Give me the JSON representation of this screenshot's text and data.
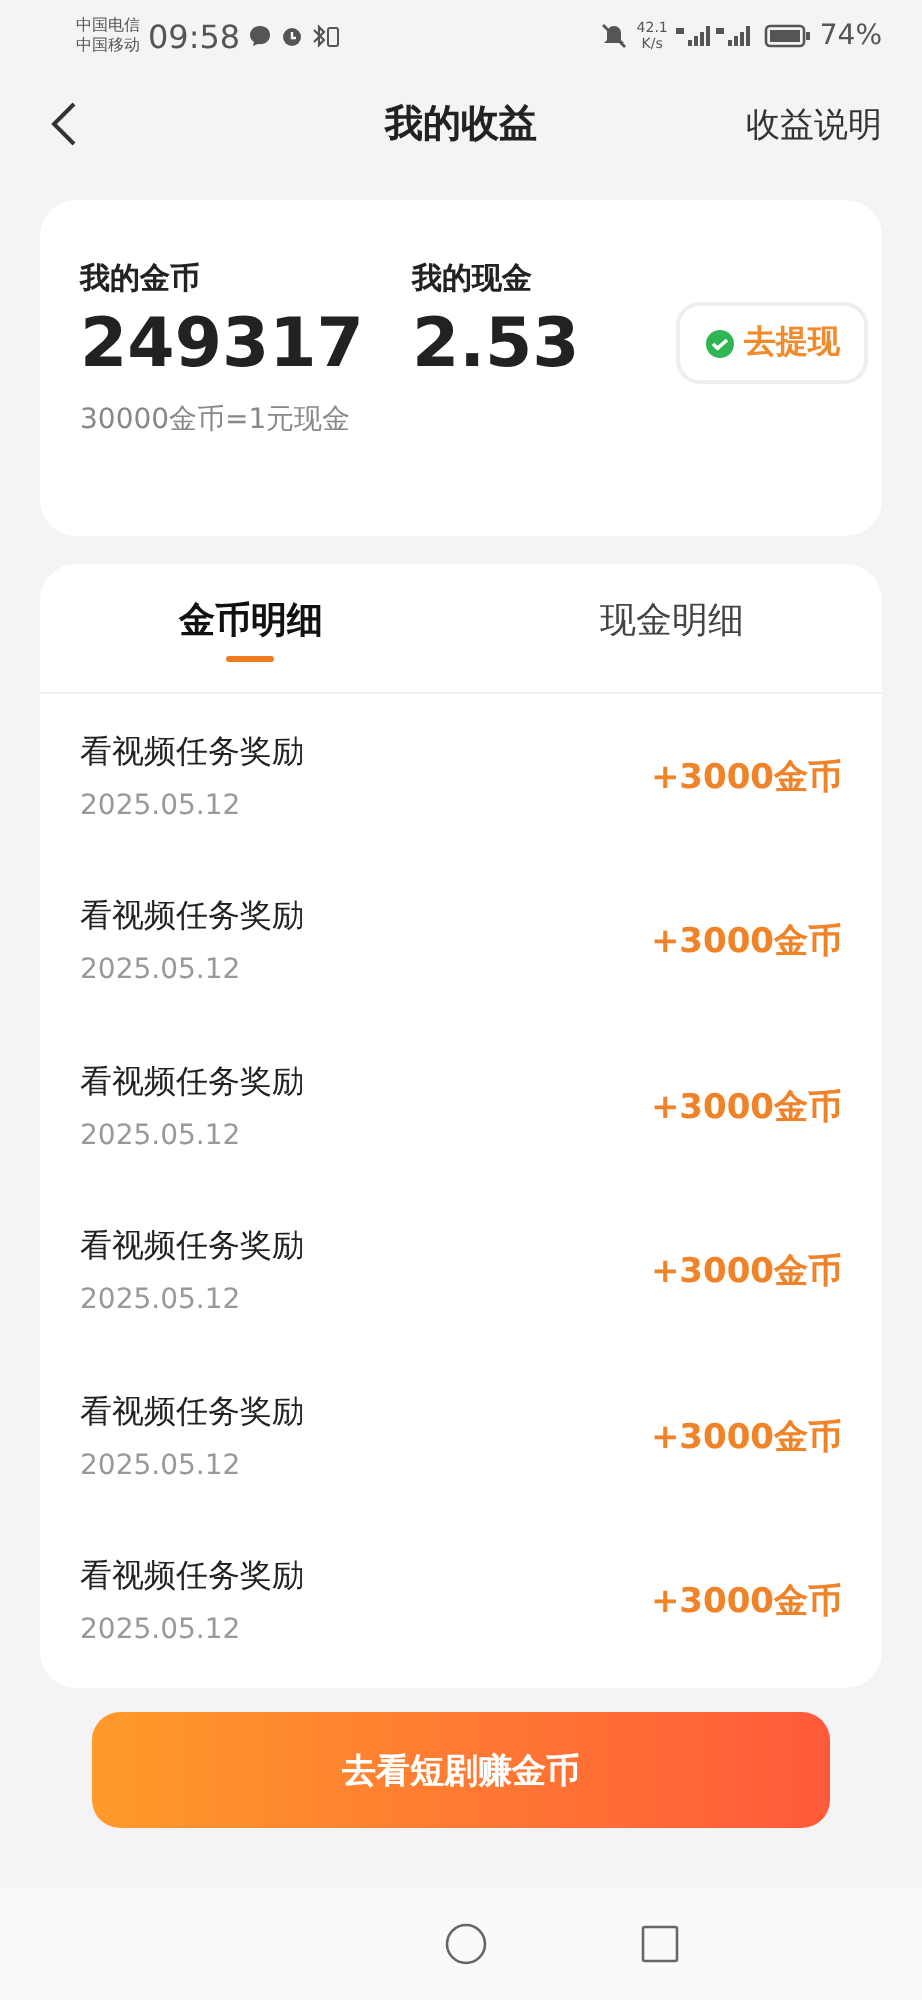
{
  "status_bar": {
    "carrier_1": "中国电信",
    "carrier_2": "中国移动",
    "time": "09:58",
    "speed": "42.1",
    "speed_unit": "K/s",
    "battery": "74%"
  },
  "header": {
    "title": "我的收益",
    "link": "收益说明"
  },
  "summary": {
    "coins_label": "我的金币",
    "coins": "249317",
    "cash_label": "我的现金",
    "cash": "2.53",
    "withdraw": "去提现",
    "rate": "30000金币=1元现金"
  },
  "tabs": [
    {
      "label": "金币明细",
      "selected": true
    },
    {
      "label": "现金明细",
      "selected": false
    }
  ],
  "records": [
    {
      "title": "看视频任务奖励",
      "date": "2025.05.12",
      "amount": "+3000金币"
    },
    {
      "title": "看视频任务奖励",
      "date": "2025.05.12",
      "amount": "+3000金币"
    },
    {
      "title": "看视频任务奖励",
      "date": "2025.05.12",
      "amount": "+3000金币"
    },
    {
      "title": "看视频任务奖励",
      "date": "2025.05.12",
      "amount": "+3000金币"
    },
    {
      "title": "看视频任务奖励",
      "date": "2025.05.12",
      "amount": "+3000金币"
    },
    {
      "title": "看视频任务奖励",
      "date": "2025.05.12",
      "amount": "+3000金币"
    }
  ],
  "action_button": "去看短剧赚金币"
}
